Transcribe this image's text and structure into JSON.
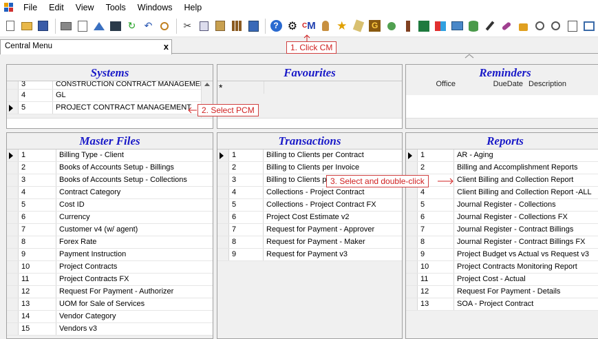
{
  "menu": {
    "items": [
      "File",
      "Edit",
      "View",
      "Tools",
      "Windows",
      "Help"
    ]
  },
  "toolbar": {
    "icons": [
      "new-icon",
      "open-icon",
      "save-icon",
      "print-icon",
      "print-preview-icon",
      "upload-icon",
      "cs-icon",
      "refresh-icon",
      "undo-icon",
      "find-icon",
      "cut-icon",
      "copy-icon",
      "paste-icon",
      "grid-icon",
      "list-icon",
      "help-icon",
      "settings-icon",
      "cm-icon",
      "person-icon",
      "star-icon",
      "tag-icon",
      "g-icon",
      "user-icon",
      "brush-icon",
      "excel-icon",
      "shapes-icon",
      "folder-icon",
      "db-icon",
      "tool-icon",
      "key-icon",
      "lock-icon",
      "zoom-out-icon",
      "zoom-in-icon",
      "page-icon",
      "window-icon"
    ],
    "cm_label": "M",
    "cm_prefix": "C"
  },
  "tab": {
    "label": "Central Menu",
    "close": "x"
  },
  "callouts": {
    "c1": "1. Click CM",
    "c2": "2. Select PCM",
    "c3": "3. Select and double-click"
  },
  "systems": {
    "title": "Systems",
    "rows": [
      {
        "no": "3",
        "name": "CONSTRUCTION CONTRACT MANAGEMENT"
      },
      {
        "no": "4",
        "name": "GL"
      },
      {
        "no": "5",
        "name": "PROJECT CONTRACT MANAGEMENT"
      }
    ]
  },
  "favourites": {
    "title": "Favourites",
    "marker": "*"
  },
  "reminders": {
    "title": "Reminders",
    "cols": [
      "Office",
      "DueDate",
      "Description"
    ]
  },
  "master": {
    "title": "Master Files",
    "rows": [
      {
        "no": "1",
        "name": "Billing Type - Client"
      },
      {
        "no": "2",
        "name": "Books  of Accounts Setup - Billings"
      },
      {
        "no": "3",
        "name": "Books of Accounts Setup - Collections"
      },
      {
        "no": "4",
        "name": "Contract Category"
      },
      {
        "no": "5",
        "name": "Cost ID"
      },
      {
        "no": "6",
        "name": "Currency"
      },
      {
        "no": "7",
        "name": "Customer v4 (w/ agent)"
      },
      {
        "no": "8",
        "name": "Forex Rate"
      },
      {
        "no": "9",
        "name": "Payment Instruction"
      },
      {
        "no": "10",
        "name": "Project Contracts"
      },
      {
        "no": "11",
        "name": "Project Contracts FX"
      },
      {
        "no": "12",
        "name": "Request For Payment - Authorizer"
      },
      {
        "no": "13",
        "name": "UOM for Sale of Services"
      },
      {
        "no": "14",
        "name": "Vendor Category"
      },
      {
        "no": "15",
        "name": "Vendors v3"
      }
    ]
  },
  "transactions": {
    "title": "Transactions",
    "rows": [
      {
        "no": "1",
        "name": "Billing to Clients per Contract"
      },
      {
        "no": "2",
        "name": "Billing to Clients per Invoice"
      },
      {
        "no": "3",
        "name": "Billing to Clients per"
      },
      {
        "no": "4",
        "name": "Collections - Project Contract"
      },
      {
        "no": "5",
        "name": "Collections - Project Contract FX"
      },
      {
        "no": "6",
        "name": "Project Cost Estimate v2"
      },
      {
        "no": "7",
        "name": "Request for Payment - Approver"
      },
      {
        "no": "8",
        "name": "Request for Payment - Maker"
      },
      {
        "no": "9",
        "name": "Request for Payment v3"
      }
    ]
  },
  "reports": {
    "title": "Reports",
    "rows": [
      {
        "no": "1",
        "name": "AR - Aging"
      },
      {
        "no": "2",
        "name": "Billing and Accomplishment Reports"
      },
      {
        "no": "3",
        "name": "Client Billing and Collection Report"
      },
      {
        "no": "4",
        "name": "Client Billing and Collection Report -ALL"
      },
      {
        "no": "5",
        "name": "Journal Register - Collections"
      },
      {
        "no": "6",
        "name": "Journal Register - Collections FX"
      },
      {
        "no": "7",
        "name": "Journal Register - Contract Billings"
      },
      {
        "no": "8",
        "name": "Journal Register - Contract Billings FX"
      },
      {
        "no": "9",
        "name": "Project Budget vs Actual vs Request v3"
      },
      {
        "no": "10",
        "name": "Project Contracts Monitoring Report"
      },
      {
        "no": "11",
        "name": "Project Cost - Actual"
      },
      {
        "no": "12",
        "name": "Request For Payment - Details"
      },
      {
        "no": "13",
        "name": "SOA - Project Contract"
      }
    ]
  }
}
